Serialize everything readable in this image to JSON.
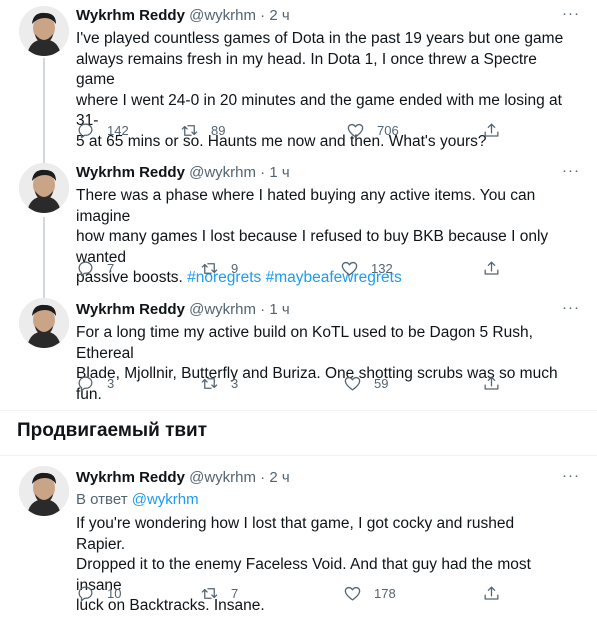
{
  "tweets": [
    {
      "author": "Wykrhm Reddy",
      "handle": "@wykrhm",
      "dot": "·",
      "time": "2 ч",
      "text": "I've played countless games of Dota in the past 19 years but one game\nalways remains fresh in my head. In Dota 1, I once threw a Spectre game\nwhere I went 24-0 in 20 minutes and the game ended with me losing at 31-\n5 at 65 mins or so. Haunts me now and then. What's yours?",
      "replies": "142",
      "retweets": "89",
      "likes": "706"
    },
    {
      "author": "Wykrhm Reddy",
      "handle": "@wykrhm",
      "dot": "·",
      "time": "1 ч",
      "text": "There was a phase where I hated buying any active items. You can imagine\nhow many games I lost because I refused to buy BKB because I only wanted\npassive boosts. ",
      "hashtags": [
        "#noregrets",
        "#maybeafewregrets"
      ],
      "replies": "7",
      "retweets": "9",
      "likes": "132"
    },
    {
      "author": "Wykrhm Reddy",
      "handle": "@wykrhm",
      "dot": "·",
      "time": "1 ч",
      "text": "For a long time my active build on KoTL used to be Dagon 5 Rush, Ethereal\nBlade, Mjollnir, Butterfly and Buriza. One shotting scrubs was so much fun.",
      "replies": "3",
      "retweets": "3",
      "likes": "59"
    }
  ],
  "promoted": {
    "section_title": "Продвигаемый твит",
    "author": "Wykrhm Reddy",
    "handle": "@wykrhm",
    "dot": "·",
    "time": "2 ч",
    "reply_prefix": "В ответ ",
    "reply_mention": "@wykrhm",
    "text": "If you're wondering how I lost that game, I got cocky and rushed Rapier.\nDropped it to the enemy Faceless Void. And that guy had the most insane\nluck on Backtracks. Insane.",
    "replies": "10",
    "retweets": "7",
    "likes": "178"
  },
  "more_label": "···",
  "icons": [
    "reply-icon",
    "retweet-icon",
    "like-icon",
    "share-icon",
    "more-icon"
  ],
  "colors": {
    "link": "#1d9bf0",
    "muted": "#536471",
    "text": "#0f1419"
  }
}
